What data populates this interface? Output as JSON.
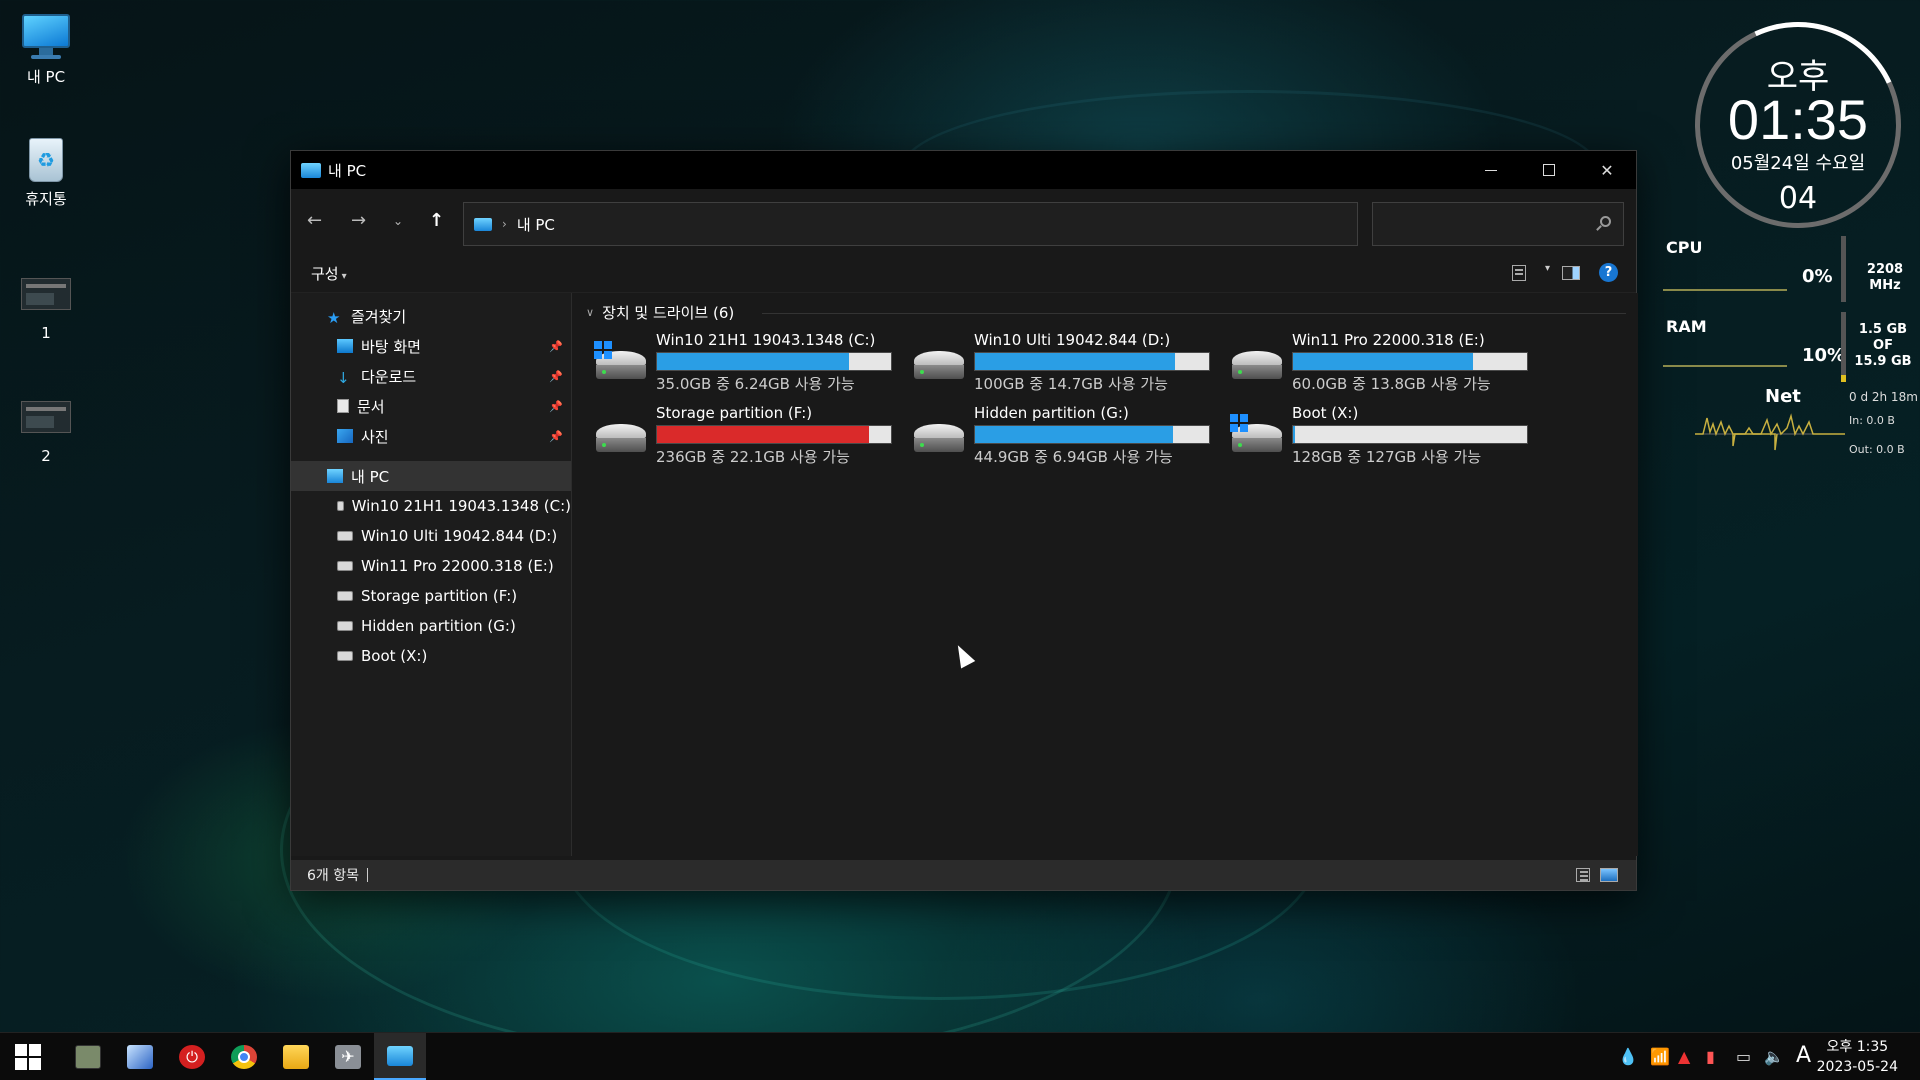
{
  "desktop": {
    "icons": [
      {
        "label": "내 PC"
      },
      {
        "label": "휴지통"
      },
      {
        "label": "1"
      },
      {
        "label": "2"
      }
    ]
  },
  "window": {
    "title": "내 PC",
    "address": "내 PC",
    "search_placeholder": "",
    "toolbar": {
      "organize": "구성"
    },
    "nav": {
      "quick_access": "즐겨찾기",
      "pinned": [
        {
          "label": "바탕 화면",
          "icon": "desktop-icon"
        },
        {
          "label": "다운로드",
          "icon": "download-icon"
        },
        {
          "label": "문서",
          "icon": "document-icon"
        },
        {
          "label": "사진",
          "icon": "pictures-icon"
        }
      ],
      "this_pc": "내 PC",
      "drives": [
        "Win10 21H1 19043.1348 (C:)",
        "Win10 Ulti 19042.844 (D:)",
        "Win11 Pro 22000.318 (E:)",
        "Storage partition (F:)",
        "Hidden partition (G:)",
        "Boot (X:)"
      ]
    },
    "group_header": "장치 및 드라이브 (6)",
    "drives": [
      {
        "name": "Win10 21H1 19043.1348 (C:)",
        "space": "35.0GB 중 6.24GB 사용 가능",
        "used_fraction": 0.82,
        "color": "#2a9ee5",
        "windows": true
      },
      {
        "name": "Win10 Ulti 19042.844 (D:)",
        "space": "100GB 중 14.7GB 사용 가능",
        "used_fraction": 0.853,
        "color": "#2a9ee5",
        "windows": false
      },
      {
        "name": "Win11 Pro 22000.318 (E:)",
        "space": "60.0GB 중 13.8GB 사용 가능",
        "used_fraction": 0.77,
        "color": "#2a9ee5",
        "windows": false
      },
      {
        "name": "Storage partition (F:)",
        "space": "236GB 중 22.1GB 사용 가능",
        "used_fraction": 0.906,
        "color": "#da2a2a",
        "windows": false
      },
      {
        "name": "Hidden partition (G:)",
        "space": "44.9GB 중 6.94GB 사용 가능",
        "used_fraction": 0.845,
        "color": "#2a9ee5",
        "windows": false
      },
      {
        "name": "Boot (X:)",
        "space": "128GB 중 127GB 사용 가능",
        "used_fraction": 0.008,
        "color": "#2a9ee5",
        "windows": true
      }
    ],
    "status": "6개 항목"
  },
  "widgets": {
    "clock": {
      "ampm": "오후",
      "time": "01:35",
      "date": "05월24일 수요일",
      "seconds": "04"
    },
    "cpu": {
      "label": "CPU",
      "percent": "0%",
      "freq": "2208 MHz"
    },
    "ram": {
      "label": "RAM",
      "percent": "10%",
      "used": "1.5 GB",
      "of": "OF",
      "total": "15.9 GB"
    },
    "net": {
      "label": "Net",
      "uptime": "0 d 2h 18m",
      "in": "In: 0.0 B",
      "out": "Out: 0.0 B"
    }
  },
  "taskbar": {
    "items": [
      "start-icon",
      "device-manager-icon",
      "system-tool-icon",
      "power-icon",
      "chrome-icon",
      "file-explorer-icon",
      "launcher-icon",
      "this-pc-icon"
    ],
    "tray_ime": "A",
    "time": "오후 1:35",
    "date": "2023-05-24"
  }
}
